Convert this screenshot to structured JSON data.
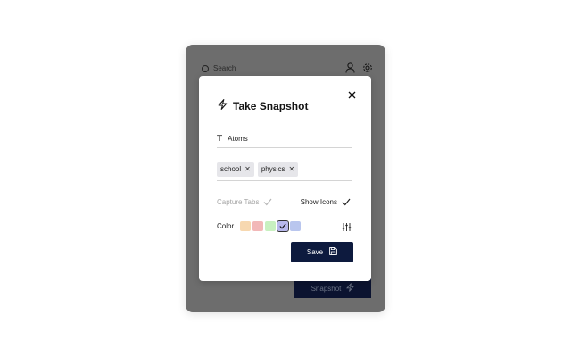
{
  "background_popup": {
    "search_placeholder": "Search",
    "snapshot_button_label": "Snapshot",
    "icons": [
      "user-icon",
      "gear-icon",
      "search-icon",
      "lightning-icon"
    ]
  },
  "modal": {
    "title": "Take Snapshot",
    "title_icon": "lightning-icon",
    "close_icon": "close-icon",
    "name_field": {
      "icon": "text-icon",
      "value": "Atoms"
    },
    "tags": [
      {
        "label": "school"
      },
      {
        "label": "physics"
      }
    ],
    "options": {
      "capture_tabs": {
        "label": "Capture Tabs",
        "checked": true,
        "disabled": true
      },
      "show_icons": {
        "label": "Show Icons",
        "checked": true,
        "disabled": false
      }
    },
    "color": {
      "label": "Color",
      "swatches": [
        "#f7d8b0",
        "#f2b8b8",
        "#c8f0c0",
        "#b8b8ec",
        "#b9c6ee"
      ],
      "selected_index": 3,
      "settings_icon": "sliders-icon"
    },
    "save_label": "Save",
    "save_icon": "floppy-disk-icon"
  },
  "colors": {
    "primary_button": "#0d1a3e",
    "overlay_background": "#6d6d6d"
  }
}
